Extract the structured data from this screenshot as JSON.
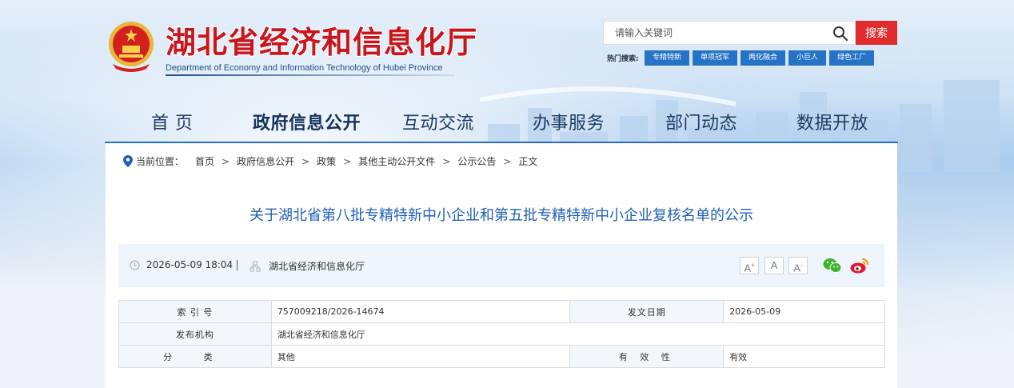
{
  "header": {
    "site_title": "湖北省经济和信息化厅",
    "site_subtitle": "Department of Economy and Information Technology of Hubei Province"
  },
  "search": {
    "placeholder": "请输入关键词",
    "button_label": "搜索",
    "hot_label": "热门搜索:",
    "hot_tags": [
      "专精特新",
      "单项冠军",
      "两化融合",
      "小巨人",
      "绿色工厂"
    ]
  },
  "nav": {
    "items": [
      "首 页",
      "政府信息公开",
      "互动交流",
      "办事服务",
      "部门动态",
      "数据开放"
    ],
    "active_index": 1
  },
  "breadcrumb": {
    "label": "当前位置：",
    "items": [
      "首页",
      "政府信息公开",
      "政策",
      "其他主动公开文件",
      "公示公告",
      "正文"
    ],
    "separator": ">"
  },
  "article": {
    "title": "关于湖北省第八批专精特新中小企业和第五批专精特新中小企业复核名单的公示",
    "datetime": "2026-05-09 18:04",
    "source": "湖北省经济和信息化厅",
    "font_sizes": [
      "A+",
      "A",
      "A-"
    ]
  },
  "share": {
    "icons": [
      "wechat-icon",
      "weibo-icon"
    ]
  },
  "info": {
    "index_label": "索 引 号",
    "index_value": "757009218/2026-14674",
    "date_label": "发文日期",
    "date_value": "2026-05-09",
    "org_label": "发布机构",
    "org_value": "湖北省经济和信息化厅",
    "category_label": "分 类",
    "category_value": "其他",
    "validity_label": "有 效 性",
    "validity_value": "有效"
  },
  "colors": {
    "title_red": "#c8161d",
    "nav_blue": "#2a6ec1",
    "search_red": "#e02c2c",
    "tag_blue": "#2673c6",
    "article_title_blue": "#1f5fb4"
  }
}
